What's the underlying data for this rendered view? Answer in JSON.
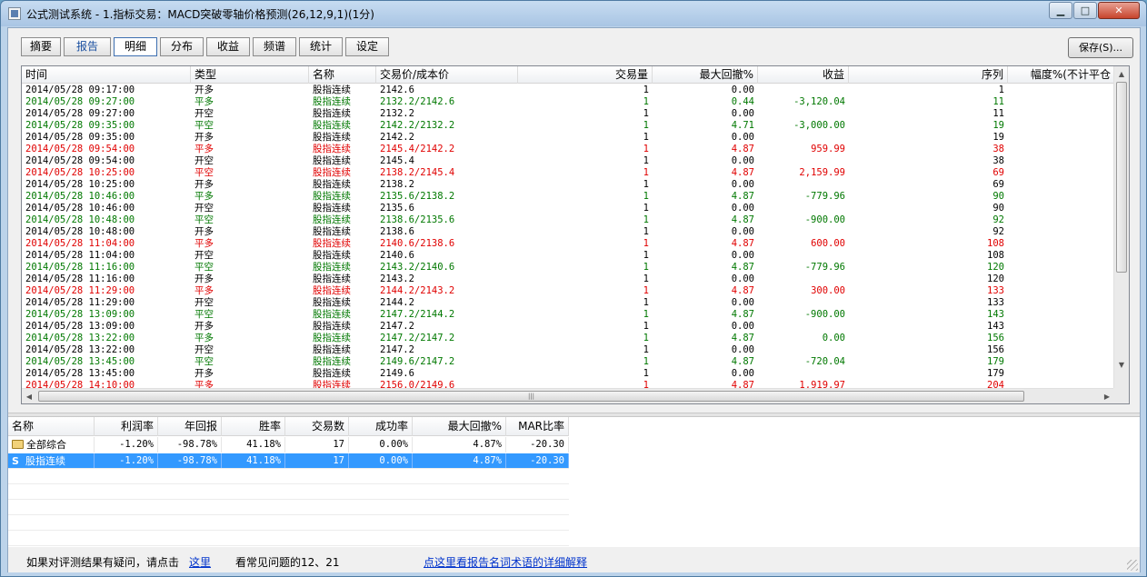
{
  "window": {
    "title": "公式测试系统 - 1.指标交易：MACD突破零轴价格预测(26,12,9,1)(1分)",
    "minimize_icon": "minimize-icon",
    "maximize_icon": "maximize-icon",
    "close_icon": "close-icon"
  },
  "tabs": [
    {
      "label": "摘要"
    },
    {
      "label": "报告"
    },
    {
      "label": "明细",
      "active": true
    },
    {
      "label": "分布"
    },
    {
      "label": "收益"
    },
    {
      "label": "频谱"
    },
    {
      "label": "统计"
    },
    {
      "label": "设定"
    }
  ],
  "save_label": "保存(S)...",
  "colors": {
    "black": "#000000",
    "green": "#007800",
    "red": "#e00000",
    "selection": "#3399ff",
    "link": "#0033cc"
  },
  "detail": {
    "columns": [
      "时间",
      "类型",
      "名称",
      "交易价/成本价",
      "交易量",
      "最大回撤%",
      "收益",
      "序列",
      "幅度%(不计平仓"
    ],
    "rows": [
      {
        "c": "k",
        "time": "2014/05/28 09:17:00",
        "type": "开多",
        "name": "股指连续",
        "price": "2142.6",
        "qty": "1",
        "dd": "0.00",
        "pnl": "",
        "seq": "1"
      },
      {
        "c": "g",
        "time": "2014/05/28 09:27:00",
        "type": "平多",
        "name": "股指连续",
        "price": "2132.2/2142.6",
        "qty": "1",
        "dd": "0.44",
        "pnl": "-3,120.04",
        "seq": "11"
      },
      {
        "c": "k",
        "time": "2014/05/28 09:27:00",
        "type": "开空",
        "name": "股指连续",
        "price": "2132.2",
        "qty": "1",
        "dd": "0.00",
        "pnl": "",
        "seq": "11"
      },
      {
        "c": "g",
        "time": "2014/05/28 09:35:00",
        "type": "平空",
        "name": "股指连续",
        "price": "2142.2/2132.2",
        "qty": "1",
        "dd": "4.71",
        "pnl": "-3,000.00",
        "seq": "19"
      },
      {
        "c": "k",
        "time": "2014/05/28 09:35:00",
        "type": "开多",
        "name": "股指连续",
        "price": "2142.2",
        "qty": "1",
        "dd": "0.00",
        "pnl": "",
        "seq": "19"
      },
      {
        "c": "r",
        "time": "2014/05/28 09:54:00",
        "type": "平多",
        "name": "股指连续",
        "price": "2145.4/2142.2",
        "qty": "1",
        "dd": "4.87",
        "pnl": "959.99",
        "seq": "38"
      },
      {
        "c": "k",
        "time": "2014/05/28 09:54:00",
        "type": "开空",
        "name": "股指连续",
        "price": "2145.4",
        "qty": "1",
        "dd": "0.00",
        "pnl": "",
        "seq": "38"
      },
      {
        "c": "r",
        "time": "2014/05/28 10:25:00",
        "type": "平空",
        "name": "股指连续",
        "price": "2138.2/2145.4",
        "qty": "1",
        "dd": "4.87",
        "pnl": "2,159.99",
        "seq": "69"
      },
      {
        "c": "k",
        "time": "2014/05/28 10:25:00",
        "type": "开多",
        "name": "股指连续",
        "price": "2138.2",
        "qty": "1",
        "dd": "0.00",
        "pnl": "",
        "seq": "69"
      },
      {
        "c": "g",
        "time": "2014/05/28 10:46:00",
        "type": "平多",
        "name": "股指连续",
        "price": "2135.6/2138.2",
        "qty": "1",
        "dd": "4.87",
        "pnl": "-779.96",
        "seq": "90"
      },
      {
        "c": "k",
        "time": "2014/05/28 10:46:00",
        "type": "开空",
        "name": "股指连续",
        "price": "2135.6",
        "qty": "1",
        "dd": "0.00",
        "pnl": "",
        "seq": "90"
      },
      {
        "c": "g",
        "time": "2014/05/28 10:48:00",
        "type": "平空",
        "name": "股指连续",
        "price": "2138.6/2135.6",
        "qty": "1",
        "dd": "4.87",
        "pnl": "-900.00",
        "seq": "92"
      },
      {
        "c": "k",
        "time": "2014/05/28 10:48:00",
        "type": "开多",
        "name": "股指连续",
        "price": "2138.6",
        "qty": "1",
        "dd": "0.00",
        "pnl": "",
        "seq": "92"
      },
      {
        "c": "r",
        "time": "2014/05/28 11:04:00",
        "type": "平多",
        "name": "股指连续",
        "price": "2140.6/2138.6",
        "qty": "1",
        "dd": "4.87",
        "pnl": "600.00",
        "seq": "108"
      },
      {
        "c": "k",
        "time": "2014/05/28 11:04:00",
        "type": "开空",
        "name": "股指连续",
        "price": "2140.6",
        "qty": "1",
        "dd": "0.00",
        "pnl": "",
        "seq": "108"
      },
      {
        "c": "g",
        "time": "2014/05/28 11:16:00",
        "type": "平空",
        "name": "股指连续",
        "price": "2143.2/2140.6",
        "qty": "1",
        "dd": "4.87",
        "pnl": "-779.96",
        "seq": "120"
      },
      {
        "c": "k",
        "time": "2014/05/28 11:16:00",
        "type": "开多",
        "name": "股指连续",
        "price": "2143.2",
        "qty": "1",
        "dd": "0.00",
        "pnl": "",
        "seq": "120"
      },
      {
        "c": "r",
        "time": "2014/05/28 11:29:00",
        "type": "平多",
        "name": "股指连续",
        "price": "2144.2/2143.2",
        "qty": "1",
        "dd": "4.87",
        "pnl": "300.00",
        "seq": "133"
      },
      {
        "c": "k",
        "time": "2014/05/28 11:29:00",
        "type": "开空",
        "name": "股指连续",
        "price": "2144.2",
        "qty": "1",
        "dd": "0.00",
        "pnl": "",
        "seq": "133"
      },
      {
        "c": "g",
        "time": "2014/05/28 13:09:00",
        "type": "平空",
        "name": "股指连续",
        "price": "2147.2/2144.2",
        "qty": "1",
        "dd": "4.87",
        "pnl": "-900.00",
        "seq": "143"
      },
      {
        "c": "k",
        "time": "2014/05/28 13:09:00",
        "type": "开多",
        "name": "股指连续",
        "price": "2147.2",
        "qty": "1",
        "dd": "0.00",
        "pnl": "",
        "seq": "143"
      },
      {
        "c": "g",
        "time": "2014/05/28 13:22:00",
        "type": "平多",
        "name": "股指连续",
        "price": "2147.2/2147.2",
        "qty": "1",
        "dd": "4.87",
        "pnl": "0.00",
        "seq": "156"
      },
      {
        "c": "k",
        "time": "2014/05/28 13:22:00",
        "type": "开空",
        "name": "股指连续",
        "price": "2147.2",
        "qty": "1",
        "dd": "0.00",
        "pnl": "",
        "seq": "156"
      },
      {
        "c": "g",
        "time": "2014/05/28 13:45:00",
        "type": "平空",
        "name": "股指连续",
        "price": "2149.6/2147.2",
        "qty": "1",
        "dd": "4.87",
        "pnl": "-720.04",
        "seq": "179"
      },
      {
        "c": "k",
        "time": "2014/05/28 13:45:00",
        "type": "开多",
        "name": "股指连续",
        "price": "2149.6",
        "qty": "1",
        "dd": "0.00",
        "pnl": "",
        "seq": "179"
      },
      {
        "c": "r",
        "time": "2014/05/28 14:10:00",
        "type": "平多",
        "name": "股指连续",
        "price": "2156.0/2149.6",
        "qty": "1",
        "dd": "4.87",
        "pnl": "1,919.97",
        "seq": "204"
      }
    ],
    "vscroll_up_icon": "arrow-up-icon",
    "vscroll_down_icon": "arrow-down-icon",
    "hscroll_left_icon": "arrow-left-icon",
    "hscroll_right_icon": "arrow-right-icon",
    "hscroll_grip": "|||"
  },
  "summary": {
    "columns": [
      "名称",
      "利润率",
      "年回报",
      "胜率",
      "交易数",
      "成功率",
      "最大回撤%",
      "MAR比率"
    ],
    "rows": [
      {
        "icon": "folder-icon",
        "name": "全部综合",
        "profit": "-1.20%",
        "annual": "-98.78%",
        "win": "41.18%",
        "trades": "17",
        "success": "0.00%",
        "dd": "4.87%",
        "mar": "-20.30",
        "selected": false
      },
      {
        "icon": "s-icon",
        "icon_text": "S",
        "name": "股指连续",
        "profit": "-1.20%",
        "annual": "-98.78%",
        "win": "41.18%",
        "trades": "17",
        "success": "0.00%",
        "dd": "4.87%",
        "mar": "-20.30",
        "selected": true
      }
    ]
  },
  "status": {
    "question_text": "如果对评测结果有疑问，请点击",
    "link_here": "这里",
    "faq_text": "看常见问题的12、21",
    "link_terms": "点这里看报告名词术语的详细解释"
  }
}
